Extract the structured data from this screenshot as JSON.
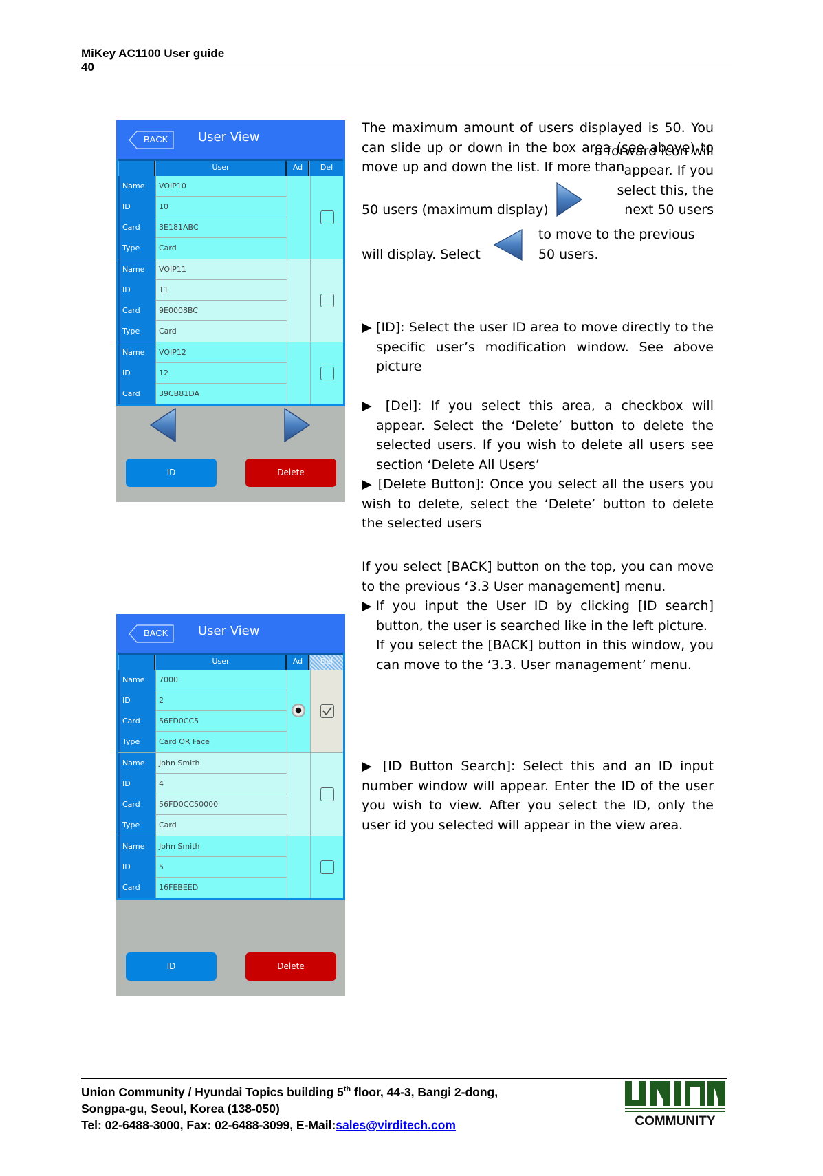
{
  "header": {
    "title": "MiKey AC1100 User guide",
    "page_number": "40"
  },
  "screens": [
    {
      "title": "User View",
      "back_label": "BACK",
      "columns": [
        "",
        "User",
        "Ad",
        "Del"
      ],
      "del_column_selected": false,
      "field_labels": [
        "Name",
        "ID",
        "Card",
        "Type"
      ],
      "users": [
        {
          "Name": "VOIP10",
          "ID": "10",
          "Card": "3E181ABC",
          "Type": "Card",
          "checked": false,
          "admin": false
        },
        {
          "Name": "VOIP11",
          "ID": "11",
          "Card": "9E0008BC",
          "Type": "Card",
          "checked": false,
          "admin": false
        },
        {
          "Name": "VOIP12",
          "ID": "12",
          "Card": "39CB81DA",
          "checked": false,
          "admin": false
        }
      ],
      "show_nav_arrows": true,
      "id_button": "ID",
      "delete_button": "Delete"
    },
    {
      "title": "User View",
      "back_label": "BACK",
      "columns": [
        "",
        "User",
        "Ad",
        "Del"
      ],
      "del_column_selected": true,
      "field_labels": [
        "Name",
        "ID",
        "Card",
        "Type"
      ],
      "users": [
        {
          "Name": "7000",
          "ID": "2",
          "Card": "56FD0CC5",
          "Type": "Card OR Face",
          "checked": true,
          "admin": true
        },
        {
          "Name": "John Smith",
          "ID": "4",
          "Card": "56FD0CC50000",
          "Type": "Card",
          "checked": false,
          "admin": false
        },
        {
          "Name": "John Smith",
          "ID": "5",
          "Card": "16FEBEED",
          "checked": false,
          "admin": false
        }
      ],
      "show_nav_arrows": false,
      "id_button": "ID",
      "delete_button": "Delete"
    }
  ],
  "text": {
    "p1_a": "The maximum amount of users displayed is 50. You can slide up or down in the box area (see above) to move up and down the list. If more than",
    "p1_b": "50 users (maximum display)",
    "p1_c": "a forward icon will appear. If you select this, the next 50 users",
    "p1_d": "will display. Select",
    "p1_e": "to move to the previous 50 users.",
    "bullet_id": "▶ [ID]: Select the user ID area to move directly to the specific user’s modification window. See above picture",
    "bullet_del": "▶ [Del]: If you select this area, a checkbox will appear. Select the ‘Delete’ button to delete the selected users. If you wish to delete all users see section ‘Delete All Users’",
    "bullet_delete_btn": "▶ [Delete Button]: Once you select all the users you wish to delete, select the ‘Delete’ button to delete the selected users",
    "back_para": "If you select [BACK] button on the top, you can move to the previous ‘3.3 User management] menu.",
    "bullet_search_a": "▶If you input the User ID by clicking [ID search] button, the user is searched like in the left picture.",
    "bullet_search_b": "If you select the [BACK] button in this window, you can move to the ‘3.3. User management’ menu.",
    "bullet_id_search": "▶ [ID Button Search]: Select this and an ID input number window will appear. Enter the ID of the user you wish to view. After you select the ID, only the user id you selected will appear in the view area."
  },
  "icons": {
    "forward": "forward-arrow-icon",
    "back": "back-arrow-icon"
  },
  "footer": {
    "line1_pre": "Union Community / Hyundai Topics building 5",
    "line1_sup": "th",
    "line1_post": " floor, 44-3, Bangi 2-dong,",
    "line2": "Songpa-gu, Seoul, Korea (138-050)",
    "line3_pre": "Tel: 02-6488-3000, Fax: 02-6488-3099, E-Mail:",
    "email": "sales@virditech.com",
    "logo_top": "UNION",
    "logo_bottom": "COMMUNITY"
  },
  "colors": {
    "titlebar": "#2f74f4",
    "row_bright": "#80fbf7",
    "row_pale": "#c6faf6",
    "id_button": "#0583e0",
    "delete_button": "#c90000",
    "logo_green": "#1e5a1e"
  }
}
